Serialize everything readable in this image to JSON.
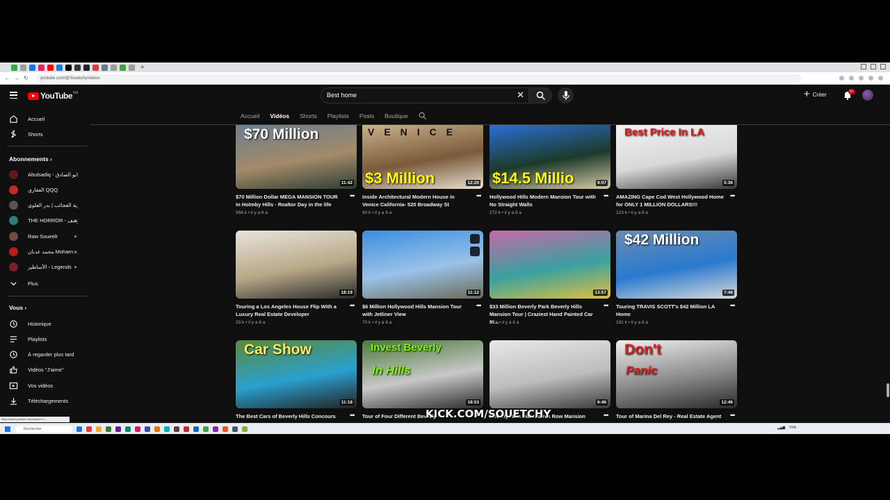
{
  "browser": {
    "url": "youtube.com/@Souetchy/videos",
    "favicon_colors": [
      "#34a853",
      "#9e9e9e",
      "#1a73e8",
      "#e91e63",
      "#ff0000",
      "#1877f2",
      "#000000",
      "#333333",
      "#222222",
      "#e53935",
      "#607d8b",
      "#9e9e9e",
      "#43a047",
      "#9e9e9e"
    ]
  },
  "header": {
    "logo_text": "YouTube",
    "logo_country": "MA",
    "search_value": "Best home",
    "create_label": "Créer",
    "notif_badge": "9+"
  },
  "tabs": [
    "Accueil",
    "Vidéos",
    "Shorts",
    "Playlists",
    "Posts",
    "Boutique"
  ],
  "active_tab": "Vidéos",
  "sidebar": {
    "main": [
      {
        "label": "Accueil",
        "icon": "home-icon"
      },
      {
        "label": "Shorts",
        "icon": "shorts-icon"
      }
    ],
    "subscriptions_title": "Abonnements",
    "subscriptions": [
      {
        "label": "Abulsadiq - ابو الصادق",
        "color": "#5a1a1a",
        "dot": false
      },
      {
        "label": "العقاري QQQ",
        "color": "#c62828",
        "dot": false
      },
      {
        "label": "قرية العجائب | بدر العلوي",
        "color": "#555555",
        "dot": false
      },
      {
        "label": "THE HORROR - يوسف",
        "color": "#2e7d7d",
        "dot": true
      },
      {
        "label": "Raw Soueelt",
        "color": "#6d4c41",
        "dot": true
      },
      {
        "label": "محمد عدنان Moharn…",
        "color": "#b71c1c",
        "dot": true
      },
      {
        "label": "الأساطير - Legends",
        "color": "#7b1f2a",
        "dot": true
      }
    ],
    "more_label": "Plus",
    "you_title": "Vous",
    "you_items": [
      {
        "label": "Historique",
        "icon": "history-icon"
      },
      {
        "label": "Playlists",
        "icon": "playlists-icon"
      },
      {
        "label": "À regarder plus tard",
        "icon": "watch-later-icon"
      },
      {
        "label": "Vidéos \"J'aime\"",
        "icon": "like-icon"
      },
      {
        "label": "Vos vidéos",
        "icon": "your-videos-icon"
      },
      {
        "label": "Téléchargements",
        "icon": "download-icon"
      }
    ]
  },
  "videos": [
    {
      "title": "$70 Million Dollar MEGA MANSION TOUR in Holmby Hills - Realtor Day in the life",
      "meta": "956 k • il y a 6 a",
      "duration": "11:42",
      "overlay": "$70 Million",
      "bg": [
        "#6b7f8e",
        "#a38a6a",
        "#2b3d33"
      ],
      "overlay_color": "#ffffff",
      "overlay_pos": "top"
    },
    {
      "title": "Inside Architectural Modern House in Venice California- 520 Broadway St",
      "meta": "90 k • il y a 6 a",
      "duration": "12:20",
      "overlay": "$3 Million",
      "top_text": "VENICE",
      "bg": [
        "#c9b28c",
        "#7a5a3a",
        "#e8e0d0"
      ],
      "overlay_color": "#ffff00",
      "overlay_pos": "bottom"
    },
    {
      "title": "Hollywood Hills Modern Mansion Tour with No Straight Walls",
      "meta": "272 k • il y a 6 a",
      "duration": "9:07",
      "overlay": "$14.5 Millio",
      "bg": [
        "#2b6fd6",
        "#1c3a2a",
        "#d9c9a8"
      ],
      "overlay_color": "#ffff00",
      "overlay_pos": "bottom"
    },
    {
      "title": "AMAZING Cape Cod West Hollywood Home for ONLY 1 MILLION DOLLARS!!!",
      "meta": "123 k • il y a 6 a",
      "duration": "5:36",
      "overlay": "Best Price In LA",
      "bg": [
        "#f2f2f2",
        "#d8d8d8",
        "#3a3a3a"
      ],
      "overlay_color": "#e0201c",
      "overlay_pos": "top"
    },
    {
      "title": "Touring a Los Angeles House Flip With a Luxury Real Estate Developer",
      "meta": "33 k • il y a 6 a",
      "duration": "18:19",
      "overlay": "",
      "bg": [
        "#e8e4dc",
        "#b8a888",
        "#2a2a2a"
      ],
      "overlay_color": "#ffffff",
      "overlay_pos": "none"
    },
    {
      "title": "$6 Million Hollywood Hills Mansion Tour with Jetliner View",
      "meta": "70 k • il y a 6 a",
      "duration": "11:12",
      "overlay": "",
      "bg": [
        "#3a8ee0",
        "#9ac2e8",
        "#6a6a5a"
      ],
      "overlay_color": "#ffffff",
      "overlay_pos": "none",
      "hover_icons": true
    },
    {
      "title": "$33 Million Beverly Park Beverly Hills Mansion Tour | Craziest Hand Painted Car In…",
      "meta": "47 k • il y a 6 a",
      "duration": "13:57",
      "overlay": "",
      "bg": [
        "#c46aa8",
        "#3aa0a0",
        "#e0c040"
      ],
      "overlay_color": "#ffffff",
      "overlay_pos": "none"
    },
    {
      "title": "Touring TRAVIS SCOTT's $42 Million LA Home",
      "meta": "191 k • il y a 6 a",
      "duration": "7:48",
      "overlay": "$42 Million",
      "bg": [
        "#6a8ab0",
        "#2a7ad0",
        "#d8d8d8"
      ],
      "overlay_color": "#ffffff",
      "overlay_pos": "top"
    },
    {
      "title": "The Best Cars of Beverly Hills Concours",
      "meta": "",
      "duration": "11:18",
      "overlay": "Car Show",
      "bg": [
        "#5a8a3a",
        "#2aa0d0",
        "#222222"
      ],
      "overlay_color": "#ffee55",
      "overlay_pos": "top"
    },
    {
      "title": "Tour of Four Different Beverly",
      "meta": "",
      "duration": "18:53",
      "overlay": "Invest Beverly",
      "sub_overlay": "In Hills",
      "bg": [
        "#4a7a3a",
        "#c8c8c8",
        "#2a2a2a"
      ],
      "overlay_color": "#7cfc00",
      "overlay_pos": "top"
    },
    {
      "title": "Beverly Hills Billionaires Row Mansion",
      "meta": "",
      "duration": "6:46",
      "overlay": "",
      "bg": [
        "#e8e8e8",
        "#bdbdbd",
        "#3a3a3a"
      ],
      "overlay_color": "#ffffff",
      "overlay_pos": "none"
    },
    {
      "title": "Tour of Marina Del Rey - Real Estate Agent",
      "meta": "",
      "duration": "12:46",
      "overlay": "Don't",
      "sub_overlay": "Panic",
      "bg": [
        "#f0f0f0",
        "#8a8a8a",
        "#2a2a2a"
      ],
      "overlay_color": "#e0201c",
      "overlay_pos": "top"
    }
  ],
  "watermark": "KICK.COM/SOUETCHY",
  "status_url": "https://www.youtube.com/watch?v=…",
  "taskbar": {
    "search_placeholder": "Rechercher",
    "app_colors": [
      "#1a73e8",
      "#e53935",
      "#f9a825",
      "#2e7d32",
      "#6a1b9a",
      "#00897b",
      "#d81b60",
      "#3949ab",
      "#ef6c00",
      "#00acc1",
      "#5d4037",
      "#c62828",
      "#1565c0",
      "#43a047",
      "#8e24aa",
      "#f4511e",
      "#455a64",
      "#7cb342"
    ],
    "tray_text": "FRA"
  }
}
